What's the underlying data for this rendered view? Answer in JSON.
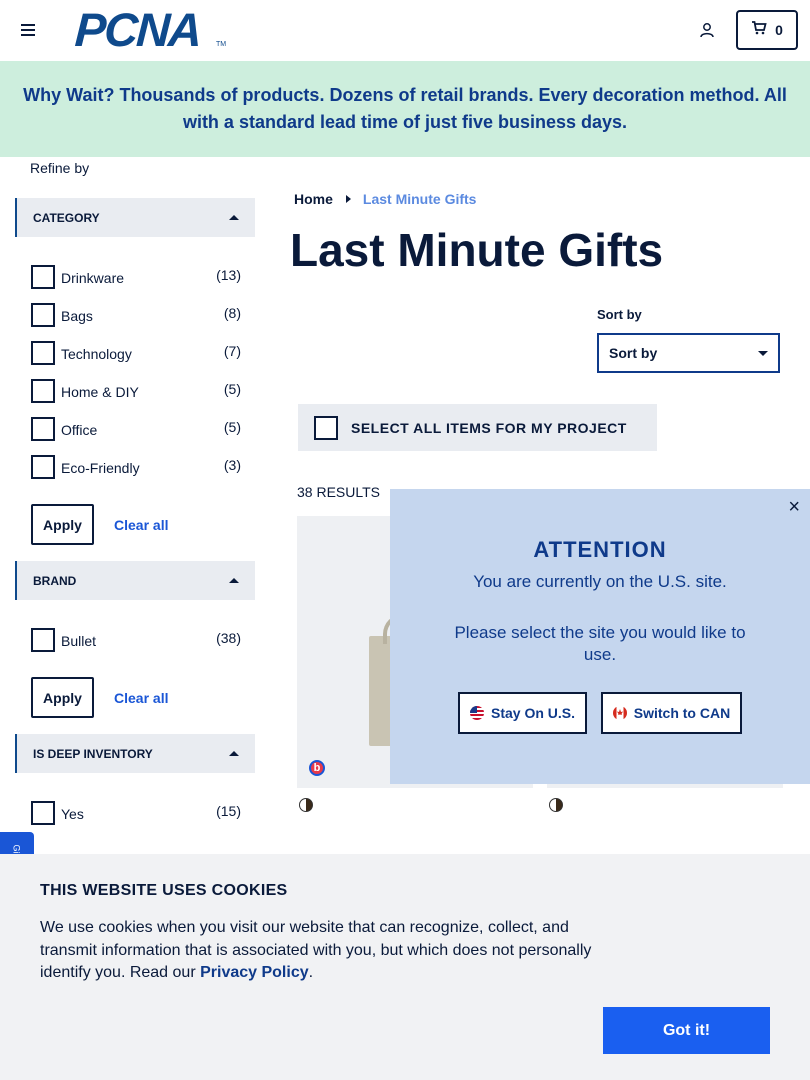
{
  "header": {
    "logo_text": "PCNA",
    "logo_tm": "TM",
    "cart_count": "0"
  },
  "banner": {
    "text": "Why Wait? Thousands of products. Dozens of retail brands. Every decoration method. All with a standard lead time of just five business days."
  },
  "sidebar": {
    "refine_label": "Refine by",
    "category": {
      "title": "CATEGORY",
      "options": [
        {
          "label": "Drinkware",
          "count": "(13)"
        },
        {
          "label": "Bags",
          "count": "(8)"
        },
        {
          "label": "Technology",
          "count": "(7)"
        },
        {
          "label": "Home & DIY",
          "count": "(5)"
        },
        {
          "label": "Office",
          "count": "(5)"
        },
        {
          "label": "Eco-Friendly",
          "count": "(3)"
        }
      ],
      "apply_label": "Apply",
      "clear_label": "Clear all"
    },
    "brand": {
      "title": "BRAND",
      "options": [
        {
          "label": "Bullet",
          "count": "(38)"
        }
      ],
      "apply_label": "Apply",
      "clear_label": "Clear all"
    },
    "deep_inventory": {
      "title": "IS DEEP INVENTORY",
      "options": [
        {
          "label": "Yes",
          "count": "(15)"
        }
      ]
    },
    "feedback_tab": "Gi"
  },
  "main": {
    "breadcrumb": {
      "home": "Home",
      "current": "Last Minute Gifts"
    },
    "title": "Last Minute Gifts",
    "sort": {
      "label": "Sort by",
      "selected": "Sort by"
    },
    "select_all_label": "SELECT ALL ITEMS FOR MY PROJECT",
    "results_label": "38 RESULTS",
    "card_badge": "b"
  },
  "modal": {
    "title": "ATTENTION",
    "message1": "You are currently on the U.S. site.",
    "message2": "Please select the site you would like to use.",
    "stay_label": "Stay On U.S.",
    "switch_label": "Switch to CAN",
    "close_glyph": "×"
  },
  "cookie": {
    "title": "THIS WEBSITE USES COOKIES",
    "body_prefix": "We use cookies when you visit our website that can recognize, collect, and transmit information that is associated with you, but which does not personally identify you. Read our ",
    "link_text": "Privacy Policy",
    "body_suffix": ".",
    "button_label": "Got it!"
  },
  "colors": {
    "brand_blue": "#0f4a8c",
    "banner_bg": "#cdeedd",
    "modal_bg": "#c5d6ee",
    "accent_link": "#1a56d6",
    "cookie_button": "#1a5ff0"
  }
}
